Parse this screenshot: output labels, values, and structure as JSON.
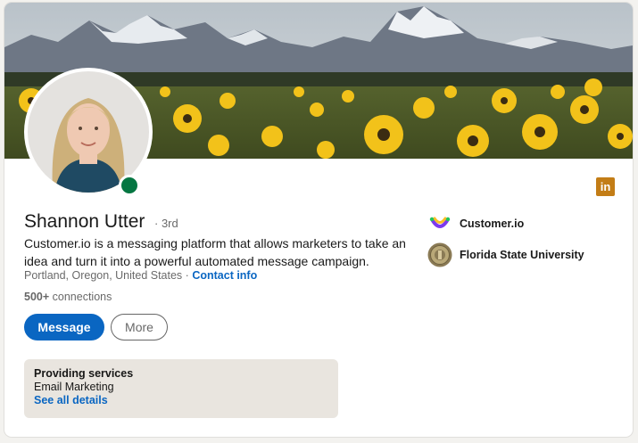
{
  "profile": {
    "name": "Shannon Utter",
    "degree": "· 3rd",
    "headline": "Customer.io is a messaging platform that allows marketers to take an idea and turn it into a powerful automated message campaign.",
    "location": "Portland, Oregon, United States",
    "separator": "·",
    "contact_link": "Contact info",
    "connections_count": "500+",
    "connections_label": "connections",
    "online_status_color": "#057642"
  },
  "actions": {
    "message_label": "Message",
    "more_label": "More"
  },
  "services": {
    "title": "Providing services",
    "item": "Email Marketing",
    "link": "See all details"
  },
  "orgs": [
    {
      "name": "Customer.io",
      "icon": "customer-io-logo"
    },
    {
      "name": "Florida State University",
      "icon": "fsu-seal-logo"
    }
  ],
  "icons": {
    "linkedin": "in"
  },
  "colors": {
    "primary": "#0a66c2",
    "linkedin_badge": "#c37d16",
    "services_bg": "#e9e5df"
  }
}
